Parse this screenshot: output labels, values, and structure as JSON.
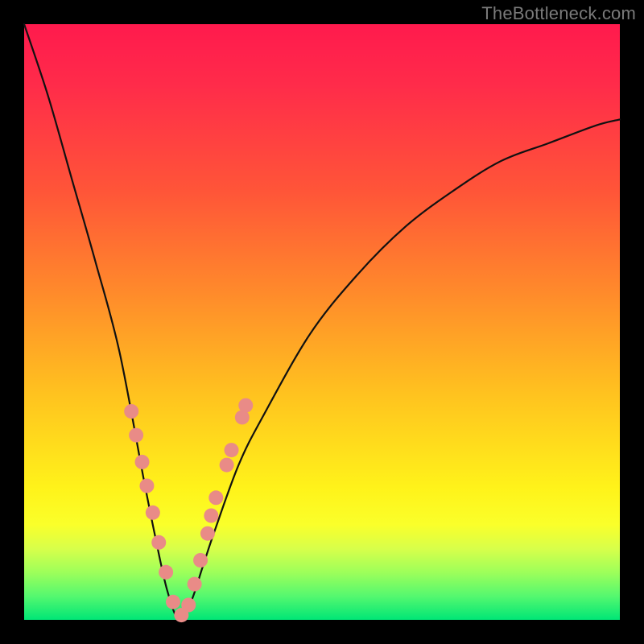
{
  "watermark": "TheBottleneck.com",
  "colors": {
    "background_frame": "#000000",
    "curve_stroke": "#111111",
    "dot_fill": "#e98b87",
    "gradient_stops": [
      "#ff1a4d",
      "#ff2b4a",
      "#ff5538",
      "#ff8a2b",
      "#ffc21f",
      "#fff31a",
      "#faff2a",
      "#d8ff4a",
      "#9eff5a",
      "#55f86f",
      "#00e676"
    ]
  },
  "chart_data": {
    "type": "line",
    "title": "",
    "xlabel": "",
    "ylabel": "",
    "xlim": [
      0,
      100
    ],
    "ylim": [
      0,
      100
    ],
    "note": "Bottleneck curve — value is mismatch %, minimum at x≈26 with value≈0. Values estimated from pixels.",
    "series": [
      {
        "name": "bottleneck_curve",
        "x": [
          0,
          4,
          8,
          12,
          16,
          20,
          22,
          24,
          26,
          28,
          30,
          32,
          36,
          40,
          48,
          56,
          64,
          72,
          80,
          88,
          96,
          100
        ],
        "y": [
          100,
          88,
          74,
          60,
          45,
          24,
          14,
          5,
          0,
          3,
          9,
          15,
          26,
          34,
          48,
          58,
          66,
          72,
          77,
          80,
          83,
          84
        ]
      }
    ],
    "highlight_points": {
      "name": "salmon_dots",
      "x": [
        18.0,
        18.8,
        19.8,
        20.6,
        21.6,
        22.6,
        23.8,
        25.0,
        26.4,
        27.6,
        28.6,
        29.6,
        30.8,
        31.4,
        32.2,
        34.0,
        34.8,
        36.6,
        37.2
      ],
      "y": [
        35.0,
        31.0,
        26.5,
        22.5,
        18.0,
        13.0,
        8.0,
        3.0,
        0.8,
        2.5,
        6.0,
        10.0,
        14.5,
        17.5,
        20.5,
        26.0,
        28.5,
        34.0,
        36.0
      ]
    }
  }
}
